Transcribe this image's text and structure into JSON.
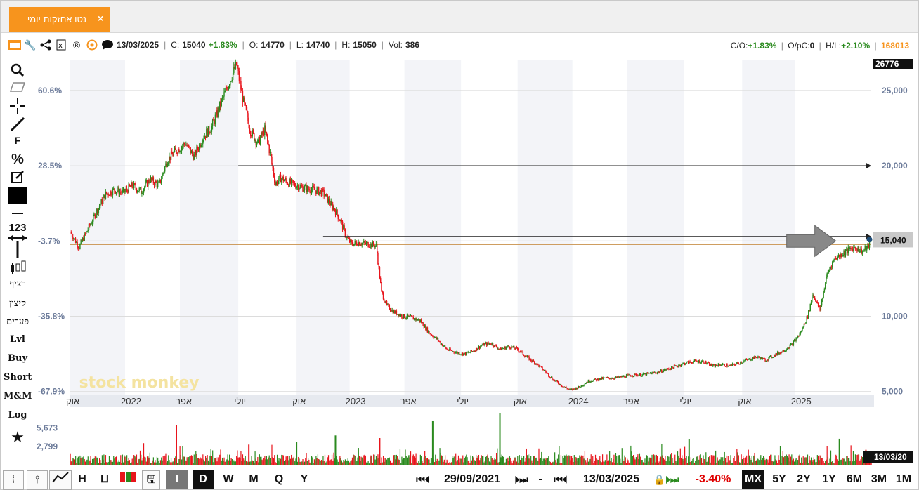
{
  "tab": {
    "title": "נטו אחזקות יומי",
    "close": "×"
  },
  "infobar": {
    "date": "13/03/2025",
    "close_label": "C:",
    "close": "15040",
    "change": "+1.83%",
    "open_label": "O:",
    "open": "14770",
    "low_label": "L:",
    "low": "14740",
    "high_label": "H:",
    "high": "15050",
    "vol_label": "Vol:",
    "vol": "386",
    "co_label": "C/O:",
    "co": "+1.83%",
    "opc_label": "O/pC:",
    "opc": "0",
    "hl_label": "H/L:",
    "hl": "+2.10%",
    "ticker": "168013"
  },
  "toolbar": {
    "fib": "F",
    "pct": "%",
    "num": "123",
    "continuous": "רציף",
    "extreme": "קיצון",
    "gaps": "פערים",
    "lvl": "Lvl",
    "buy": "Buy",
    "short": "Short",
    "mm": "M&M",
    "log": "Log"
  },
  "watermark": "stock monkey",
  "colors": {
    "up": "#2a8a1e",
    "down": "#e8141b",
    "accent": "#f7941d",
    "hline": "#c8914a"
  },
  "chart_data": {
    "type": "candlestick",
    "ylim": [
      4800,
      27000
    ],
    "y_ticks": [
      "5,000",
      "10,000",
      "15,000",
      "20,000",
      "25,000"
    ],
    "y_tick_values": [
      5000,
      10000,
      15000,
      20000,
      25000
    ],
    "pct_ticks": [
      "60.6%",
      "28.5%",
      "-3.7%",
      "-35.8%",
      "-67.9%"
    ],
    "pct_tick_values": [
      25000,
      20000,
      15000,
      10000,
      5000
    ],
    "max_label": "26776",
    "last_price_label": "15,040",
    "last_date_label": "13/03/20",
    "x_labels": [
      "אוק",
      "2022",
      "אפר",
      "יולי",
      "אוק",
      "2023",
      "אפר",
      "יולי",
      "אוק",
      "2024",
      "אפר",
      "יולי",
      "אוק",
      "2025"
    ],
    "x_label_index": [
      0,
      62,
      124,
      190,
      256,
      316,
      378,
      442,
      506,
      568,
      630,
      694,
      760,
      820
    ],
    "series": [
      {
        "values": [
          [
            0,
            15600
          ],
          [
            10,
            14600
          ],
          [
            20,
            15800
          ],
          [
            30,
            17000
          ],
          [
            40,
            18100
          ],
          [
            50,
            18400
          ],
          [
            60,
            18200
          ],
          [
            70,
            18700
          ],
          [
            80,
            18300
          ],
          [
            90,
            19100
          ],
          [
            100,
            18700
          ],
          [
            110,
            20400
          ],
          [
            120,
            21000
          ],
          [
            130,
            21500
          ],
          [
            140,
            20600
          ],
          [
            150,
            21900
          ],
          [
            160,
            22600
          ],
          [
            170,
            24100
          ],
          [
            180,
            25600
          ],
          [
            188,
            26700
          ],
          [
            196,
            24200
          ],
          [
            204,
            22300
          ],
          [
            212,
            21500
          ],
          [
            220,
            22400
          ],
          [
            226,
            20800
          ],
          [
            232,
            18800
          ],
          [
            238,
            19200
          ],
          [
            246,
            18900
          ],
          [
            256,
            18700
          ],
          [
            266,
            18500
          ],
          [
            276,
            18400
          ],
          [
            286,
            18200
          ],
          [
            294,
            17500
          ],
          [
            300,
            17000
          ],
          [
            306,
            16300
          ],
          [
            312,
            15300
          ],
          [
            318,
            14800
          ],
          [
            326,
            14900
          ],
          [
            336,
            14800
          ],
          [
            346,
            14700
          ],
          [
            352,
            11600
          ],
          [
            358,
            10700
          ],
          [
            366,
            10300
          ],
          [
            376,
            10000
          ],
          [
            386,
            9900
          ],
          [
            396,
            9700
          ],
          [
            406,
            8900
          ],
          [
            416,
            8400
          ],
          [
            426,
            7800
          ],
          [
            436,
            7600
          ],
          [
            446,
            7500
          ],
          [
            456,
            7700
          ],
          [
            466,
            8100
          ],
          [
            476,
            8200
          ],
          [
            486,
            7800
          ],
          [
            496,
            8000
          ],
          [
            506,
            7800
          ],
          [
            516,
            7300
          ],
          [
            526,
            6900
          ],
          [
            536,
            6400
          ],
          [
            546,
            5800
          ],
          [
            556,
            5400
          ],
          [
            566,
            5100
          ],
          [
            576,
            5300
          ],
          [
            586,
            5700
          ],
          [
            596,
            5800
          ],
          [
            606,
            5900
          ],
          [
            616,
            5900
          ],
          [
            626,
            6000
          ],
          [
            636,
            6100
          ],
          [
            646,
            6100
          ],
          [
            656,
            6200
          ],
          [
            666,
            6300
          ],
          [
            676,
            6500
          ],
          [
            686,
            6700
          ],
          [
            696,
            6900
          ],
          [
            706,
            7000
          ],
          [
            716,
            7000
          ],
          [
            726,
            6700
          ],
          [
            736,
            6800
          ],
          [
            746,
            6700
          ],
          [
            756,
            6900
          ],
          [
            766,
            7100
          ],
          [
            776,
            7300
          ],
          [
            786,
            7100
          ],
          [
            796,
            7400
          ],
          [
            806,
            7700
          ],
          [
            816,
            8100
          ],
          [
            826,
            8900
          ],
          [
            834,
            10000
          ],
          [
            840,
            11500
          ],
          [
            848,
            10400
          ],
          [
            856,
            12800
          ],
          [
            864,
            13800
          ],
          [
            872,
            14100
          ],
          [
            880,
            14400
          ],
          [
            888,
            14600
          ],
          [
            896,
            14300
          ],
          [
            902,
            14600
          ],
          [
            906,
            15040
          ]
        ]
      }
    ],
    "volume_ticks": [
      "5,673",
      "2,799"
    ],
    "volume_tick_values": [
      5673,
      2799
    ],
    "volume_spikes": [
      [
        120,
        6100,
        "red"
      ],
      [
        300,
        4500,
        "green"
      ],
      [
        350,
        4100,
        "red"
      ],
      [
        410,
        6800,
        "green"
      ],
      [
        486,
        7900,
        "green"
      ],
      [
        700,
        3900,
        "green"
      ],
      [
        870,
        4000,
        "green"
      ],
      [
        886,
        2100,
        "green"
      ],
      [
        900,
        2300,
        "red"
      ],
      [
        860,
        2200,
        "green"
      ],
      [
        202,
        3100,
        "red"
      ],
      [
        256,
        3500,
        "green"
      ]
    ],
    "horizontal_lines": [
      {
        "value": 15000,
        "color": "#c8914a"
      }
    ],
    "arrows": [
      {
        "x_from": 190,
        "x_to": 906,
        "value": 20000
      },
      {
        "x_from": 286,
        "x_to": 906,
        "value": 15300
      }
    ]
  },
  "bottombar": {
    "interval_i": "I",
    "interval_d": "D",
    "interval_w": "W",
    "interval_m": "M",
    "interval_q": "Q",
    "interval_y": "Y",
    "start_date": "29/09/2021",
    "end_date": "13/03/2025",
    "range_dash": "-",
    "change": "-3.40%",
    "range_mx": "MX",
    "range_5y": "5Y",
    "range_2y": "2Y",
    "range_1y": "1Y",
    "range_6m": "6M",
    "range_3m": "3M",
    "range_1m": "1M",
    "nav_first": "⏮",
    "nav_next": "⏭"
  }
}
